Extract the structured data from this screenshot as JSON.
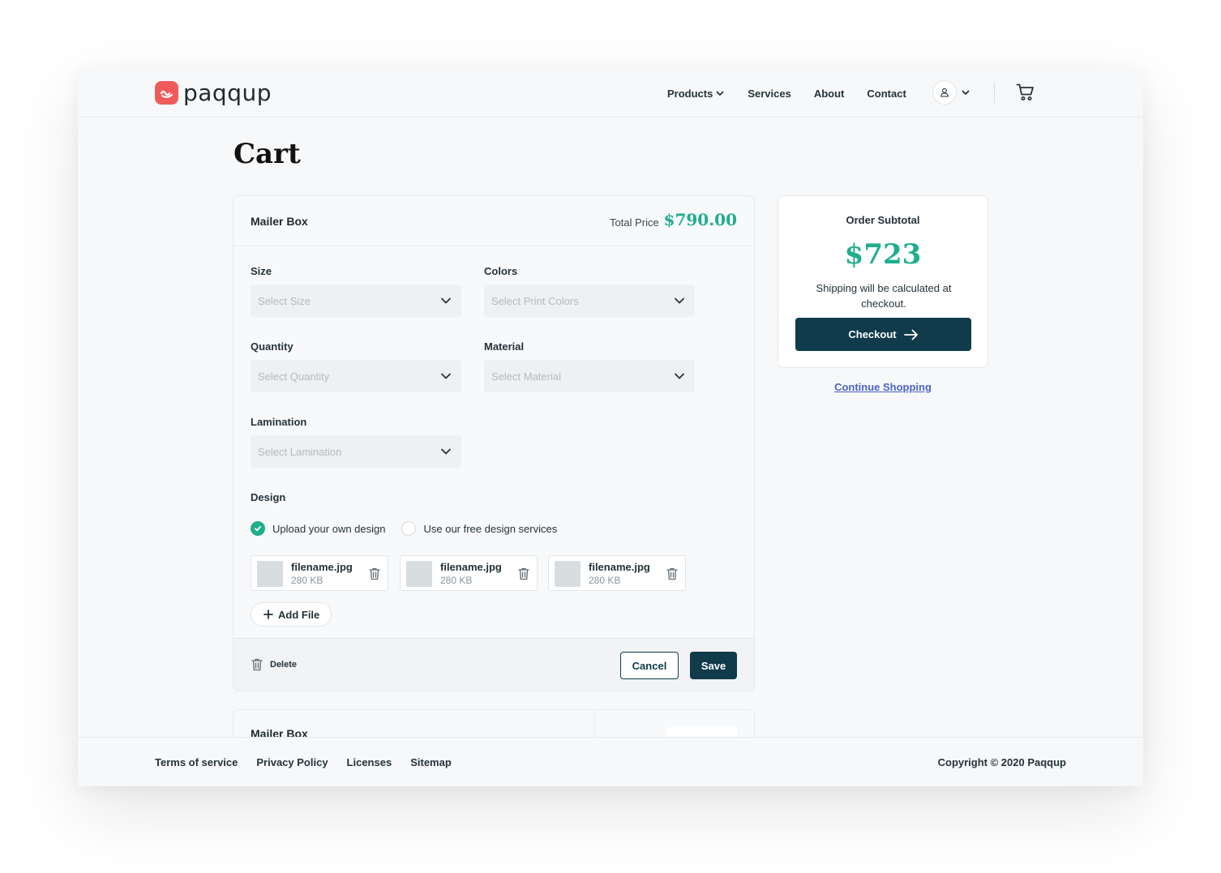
{
  "brand": {
    "name": "paqqup",
    "color": "#f05a5a"
  },
  "nav": {
    "products": "Products",
    "services": "Services",
    "about": "About",
    "contact": "Contact"
  },
  "page": {
    "title": "Cart"
  },
  "cart_item": {
    "title": "Mailer Box",
    "total_label": "Total Price",
    "total_value": "$790.00",
    "fields": {
      "size": {
        "label": "Size",
        "placeholder": "Select Size"
      },
      "colors": {
        "label": "Colors",
        "placeholder": "Select Print Colors"
      },
      "quantity": {
        "label": "Quantity",
        "placeholder": "Select Quantity"
      },
      "material": {
        "label": "Material",
        "placeholder": "Select Material"
      },
      "lamination": {
        "label": "Lamination",
        "placeholder": "Select Lamination"
      }
    },
    "design": {
      "label": "Design",
      "option_upload": "Upload your own design",
      "option_services": "Use our free design services",
      "selected": "upload"
    },
    "files": [
      {
        "name": "filename.jpg",
        "size": "280 KB"
      },
      {
        "name": "filename.jpg",
        "size": "280 KB"
      },
      {
        "name": "filename.jpg",
        "size": "280 KB"
      }
    ],
    "add_file": "Add File",
    "delete": "Delete",
    "cancel": "Cancel",
    "save": "Save"
  },
  "cart_item_2": {
    "title": "Mailer Box"
  },
  "summary": {
    "label": "Order Subtotal",
    "value": "$723",
    "note": "Shipping will be calculated at checkout.",
    "checkout": "Checkout",
    "continue": "Continue Shopping"
  },
  "footer": {
    "links": [
      "Terms of service",
      "Privacy Policy",
      "Licenses",
      "Sitemap"
    ],
    "copyright": "Copyright © 2020 Paqqup"
  },
  "colors": {
    "accent": "#1fae8e",
    "primary": "#0f3b4b",
    "link": "#4a63c7"
  }
}
